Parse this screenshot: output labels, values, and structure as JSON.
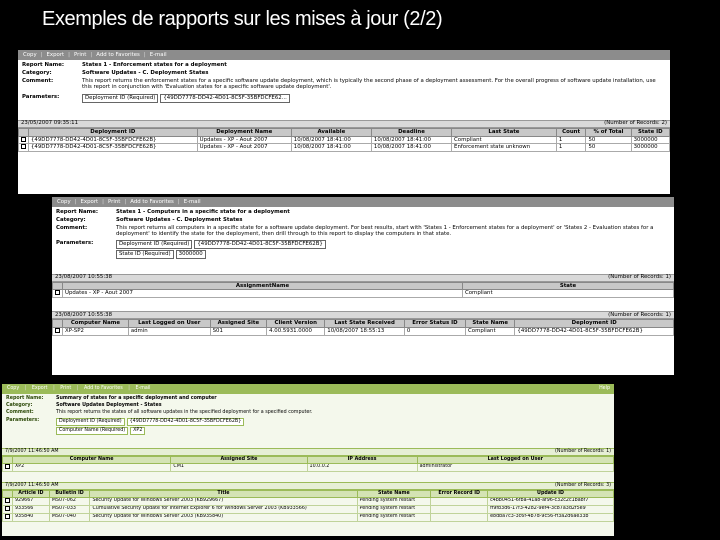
{
  "slide": {
    "title": "Exemples de rapports sur les mises à jour (2/2)"
  },
  "win1": {
    "toolbar": [
      "Copy",
      "Export",
      "Print",
      "Add to Favorites",
      "E-mail"
    ],
    "report_name_label": "Report Name:",
    "report_name": "States 1 - Enforcement states for a deployment",
    "category_label": "Category:",
    "category": "Software Updates - C. Deployment States",
    "comment_label": "Comment:",
    "comment": "This report returns the enforcement states for a specific software update deployment, which is typically the second phase of a deployment assessment. For the overall progress of software update installation, use this report in conjunction with 'Evaluation states for a specific software update deployment'.",
    "params_label": "Parameters:",
    "param_name": "Deployment ID (Required)",
    "param_value": "{49DD7778-DD42-4D01-8C5F-35BFDCFE62...",
    "datetime": "23/05/2007 09:35:11",
    "records": "(Number of Records: 2)",
    "columns": [
      "Deployment ID",
      "Deployment Name",
      "Available",
      "Deadline",
      "Last State",
      "Count",
      "% of Total",
      "State ID"
    ],
    "rows": [
      [
        "{49DD7778-DD42-4D01-8C5F-35BFDCFE62B}",
        "Updates - XP - Aout 2007",
        "10/08/2007 18:41:00",
        "10/08/2007 18:41:00",
        "Compliant",
        "1",
        "50",
        "3000000"
      ],
      [
        "{49DD7778-DD42-4D01-8C5F-35BFDCFE62B}",
        "Updates - XP - Aout 2007",
        "10/08/2007 18:41:00",
        "10/08/2007 18:41:00",
        "Enforcement state unknown",
        "1",
        "50",
        "3000000"
      ]
    ]
  },
  "win2": {
    "toolbar": [
      "Copy",
      "Export",
      "Print",
      "Add to Favorites",
      "E-mail"
    ],
    "report_name_label": "Report Name:",
    "report_name": "States 1 - Computers in a specific state for a deployment",
    "category_label": "Category:",
    "category": "Software Updates - C. Deployment States",
    "comment_label": "Comment:",
    "comment": "This report returns all computers in a specific state for a software update deployment. For best results, start with 'States 1 - Enforcement states for a deployment' or 'States 2 - Evaluation states for a deployment' to identify the state for the deployment, then drill through to this report to display the computers in that state.",
    "params_label": "Parameters:",
    "param1_name": "Deployment ID (Required)",
    "param1_value": "{49DD7778-DD42-4D01-8C5F-35BFDCFE62B}",
    "param2_name": "State ID (Required)",
    "param2_value": "3000000",
    "datetime": "23/08/2007 10:55:38",
    "records": "(Number of Records: 1)",
    "summary_columns": [
      "AssignmentName",
      "State"
    ],
    "summary_row": [
      "Updates - XP - Aout 2007",
      "Compliant"
    ],
    "datetime2": "23/08/2007 10:55:38",
    "records2": "(Number of Records: 1)",
    "columns": [
      "Computer Name",
      "Last Logged on User",
      "Assigned Site",
      "Client Version",
      "Last State Received",
      "Error Status ID",
      "State Name",
      "Deployment ID"
    ],
    "rows": [
      [
        "XP-SP2",
        "admin",
        "S01",
        "4.00.5931.0000",
        "10/08/2007 18:55:13",
        "0",
        "Compliant",
        "{49DD7778-DD42-4D01-8C5F-35BFDCFE62B}"
      ]
    ]
  },
  "win3": {
    "toolbar": [
      "Copy",
      "Export",
      "Print",
      "Add to Favorites",
      "E-mail"
    ],
    "help": "Help",
    "report_name_label": "Report Name:",
    "report_name": "Summary of states for a specific deployment and computer",
    "category_label": "Category:",
    "category": "Software Updates Deployment - States",
    "comment_label": "Comment:",
    "comment": "This report returns the states of all software updates in the specified deployment for a specified computer.",
    "params_label": "Parameters:",
    "param1_name": "Deployment ID (Required)",
    "param1_value": "{49DD7778-DD42-4D01-8C5F-35BFDCFE62B}",
    "param2_name": "Computer Name (Required)",
    "param2_value": "XP2",
    "datetime": "7/9/2007 11:46:50 AM",
    "records": "(Number of Records: 1)",
    "summary_columns": [
      "Computer Name",
      "Assigned Site",
      "IP Address",
      "Last Logged on User"
    ],
    "summary_row": [
      "XP2",
      "CM1",
      "10.0.0.2",
      "administrator"
    ],
    "datetime2": "7/9/2007 11:46:50 AM",
    "records2": "(Number of Records: 3)",
    "columns": [
      "Article ID",
      "Bulletin ID",
      "Title",
      "State Name",
      "Error Record ID",
      "Update ID"
    ],
    "rows": [
      [
        "929667",
        "MS07-062",
        "Security Update for Windows Server 2003 (KB929667)",
        "Pending system restart",
        "",
        "c4bb0451-6fba-41a8-af96-c32c2c1ba8f7"
      ],
      [
        "933566",
        "MS07-033",
        "Cumulative Security Update for Internet Explorer 6 for Windows Server 2003 (KB933566)",
        "Pending system restart",
        "",
        "ff9fb3d6-17f3-4282-9ef4-3c87a3d2f5e9"
      ],
      [
        "935840",
        "MS07-040",
        "Security Update for Windows Server 2003 (KB935840)",
        "Pending system restart",
        "",
        "e8dba7c3-3c6f-4b7d-9c56-ff3a2d6ae33b"
      ]
    ]
  }
}
